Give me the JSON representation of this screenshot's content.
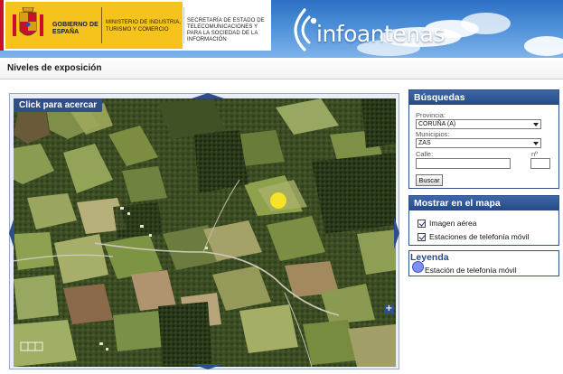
{
  "header": {
    "gov_espana": "GOBIERNO DE ESPAÑA",
    "ministerio": "MINISTERIO DE INDUSTRIA, TURISMO Y COMERCIO",
    "secretaria": "SECRETARÍA DE ESTADO DE TELECOMUNICACIONES Y PARA LA SOCIEDAD DE LA INFORMACIÓN",
    "logo": "infoantenas",
    "logo_icon": "wifi-signal-icon",
    "shield_icon": "spain-coat-of-arms-icon"
  },
  "page_title": "Niveles de exposición",
  "map": {
    "zoom_label": "Click para acercar",
    "zoom_plus": "+",
    "pan_icons": [
      "pan-up-icon",
      "pan-down-icon",
      "pan-left-icon",
      "pan-right-icon"
    ]
  },
  "search": {
    "title": "Búsquedas",
    "province_label": "Provincia:",
    "province_value": "CORUÑA (A)",
    "municipality_label": "Municipios:",
    "municipality_value": "ZAS",
    "street_label": "Calle:",
    "number_label": "nº",
    "street_value": "",
    "number_value": "",
    "button": "Buscar"
  },
  "show": {
    "title": "Mostrar en el mapa",
    "options": [
      {
        "label": "Imagen aérea",
        "checked": true
      },
      {
        "label": "Estaciones de telefonía móvil",
        "checked": true
      }
    ]
  },
  "legend": {
    "title": "Leyenda",
    "item": "Estación de telefonía móvil"
  },
  "colors": {
    "accent": "#2f4f86",
    "antenna_marker": "#f7e22a",
    "legend_marker": "#7d8ff0"
  }
}
